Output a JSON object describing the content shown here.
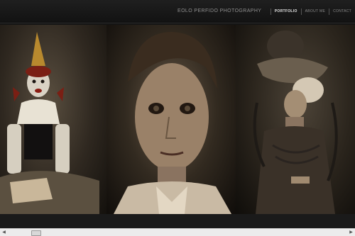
{
  "header": {
    "brand": "EOLO PERFIDO PHOTOGRAPHY",
    "nav": [
      {
        "label": "PORTFOLIO",
        "active": true
      },
      {
        "label": "ABOUT ME",
        "active": false
      },
      {
        "label": "CONTACT",
        "active": false
      }
    ]
  },
  "gallery": {
    "photos": [
      {
        "subject": "clown-portrait"
      },
      {
        "subject": "woman-portrait"
      },
      {
        "subject": "victorian-portrait"
      }
    ]
  },
  "scrollbar": {
    "left_arrow": "◀",
    "right_arrow": "▶",
    "position": 0.07
  },
  "colors": {
    "background": "#141414",
    "nav_active": "#e8e8e8",
    "nav_inactive": "#8a8a8a"
  }
}
